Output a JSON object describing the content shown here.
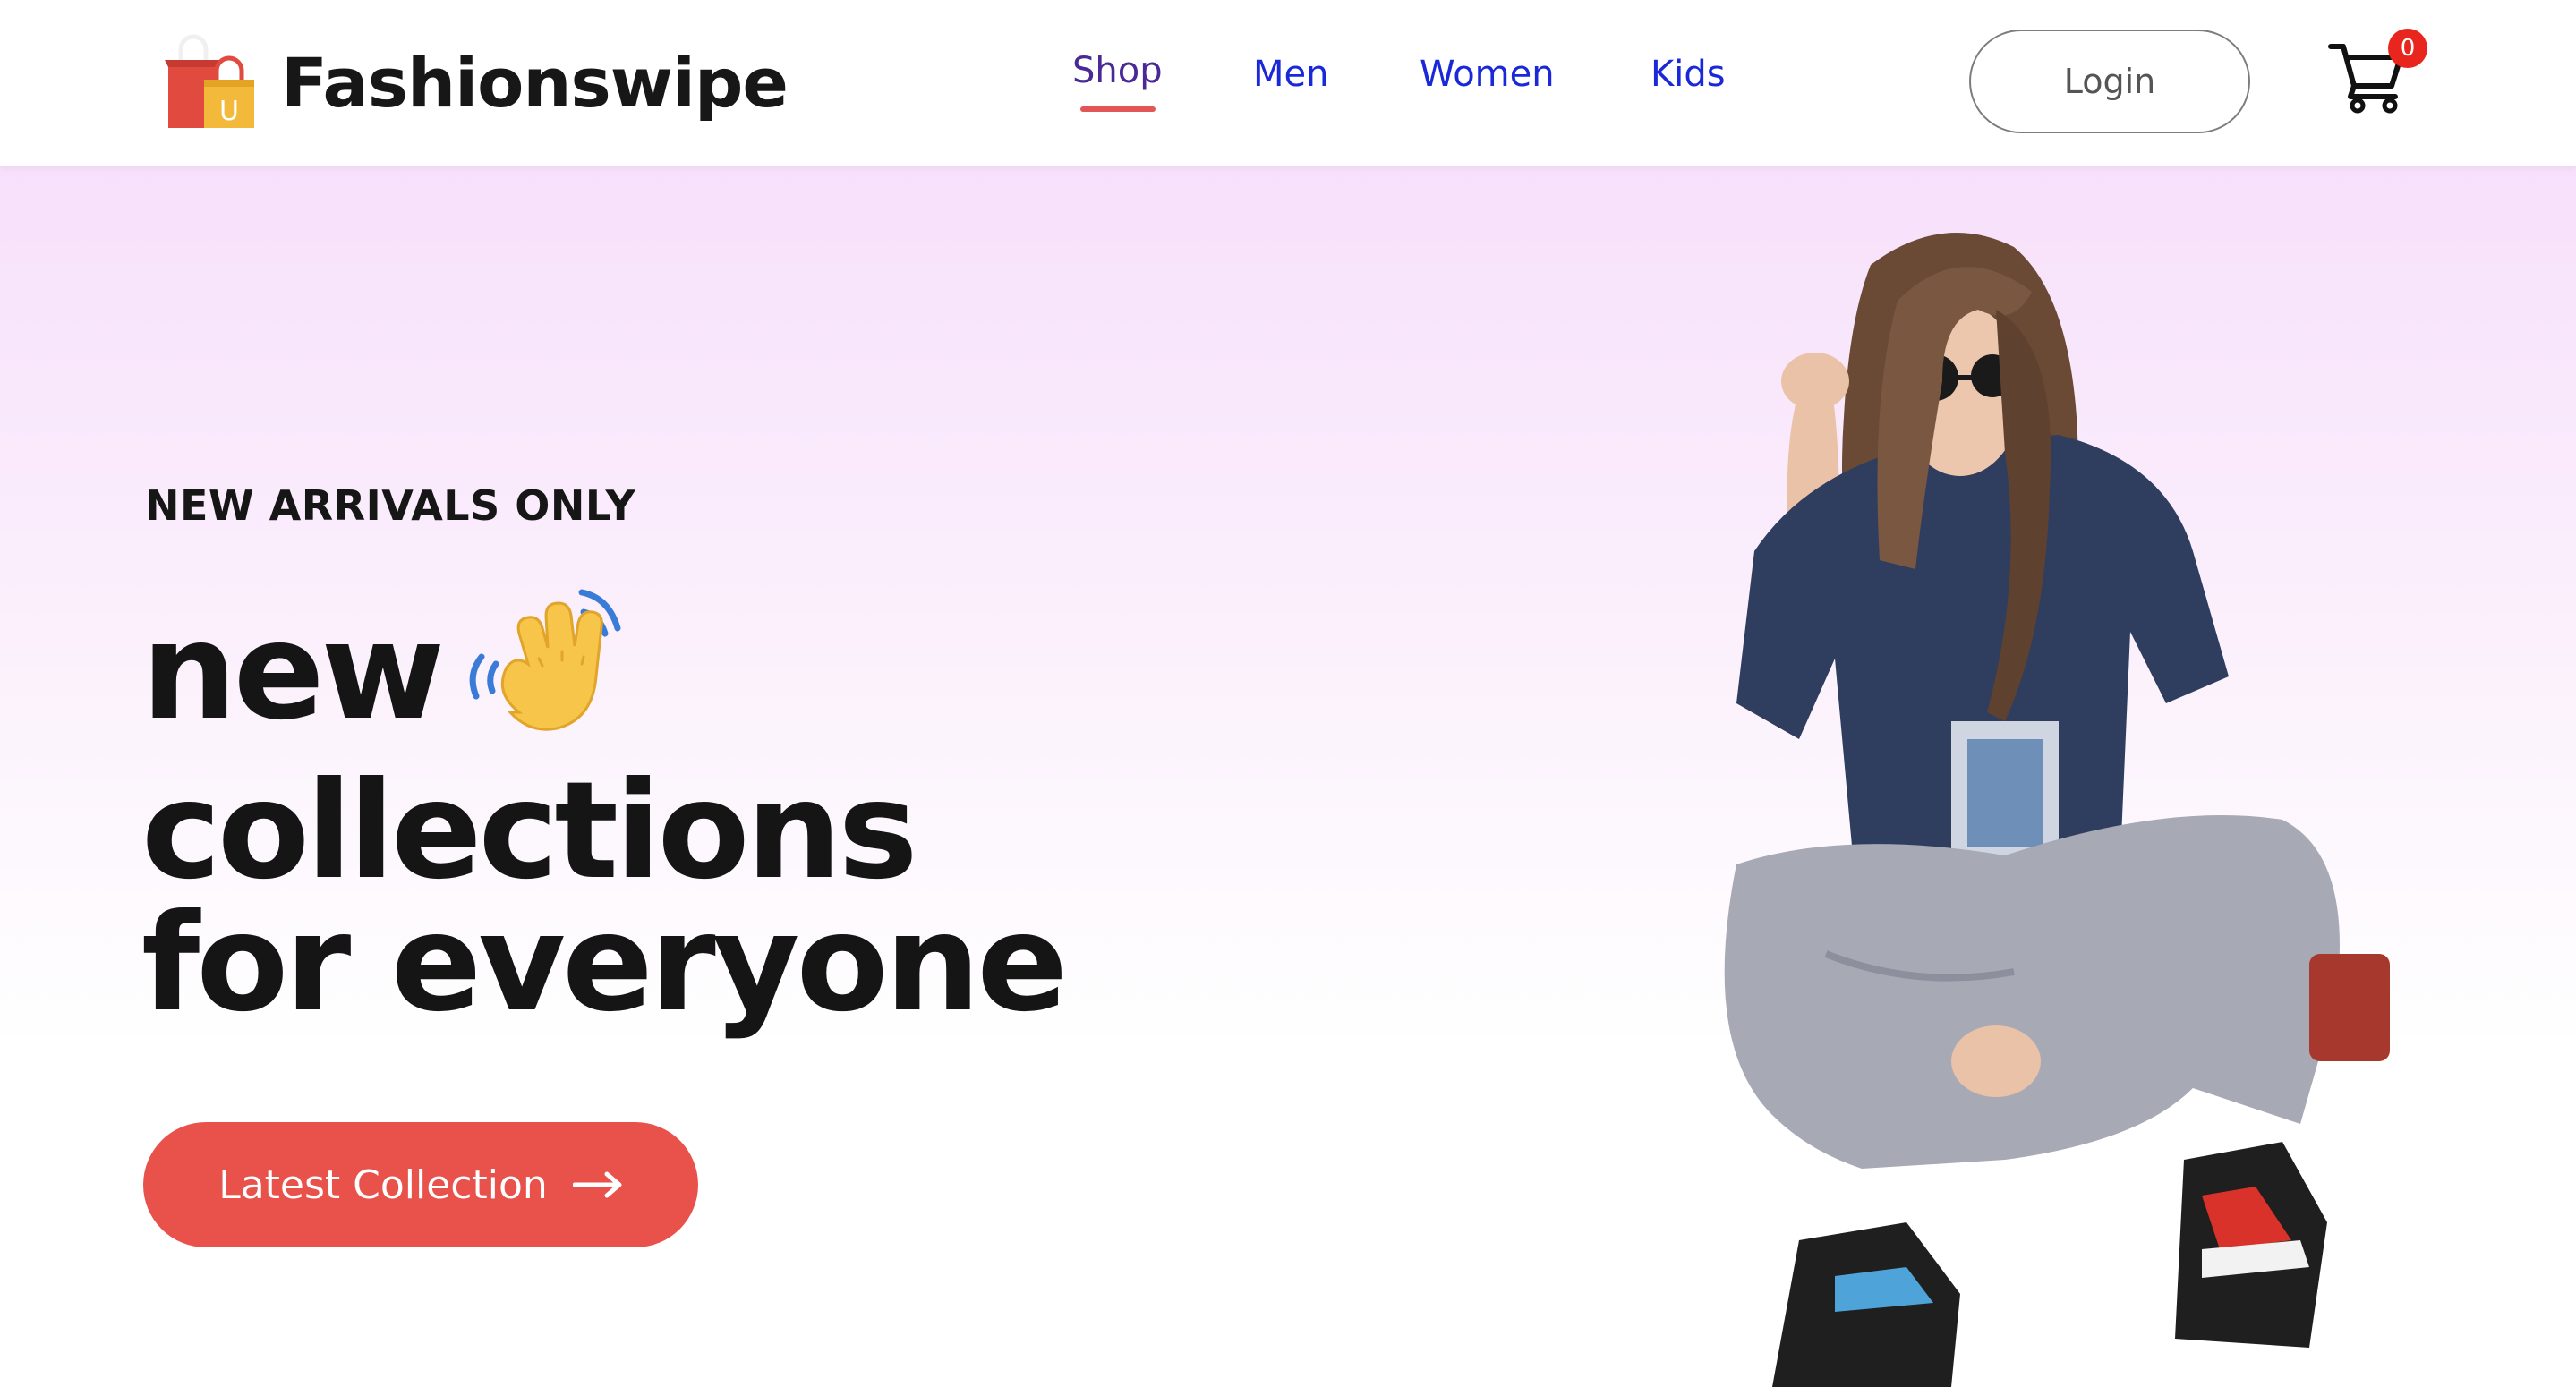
{
  "brand": {
    "name": "Fashionswipe",
    "logo_icon": "shopping-bags-icon",
    "logo_badge_letter": "U",
    "colors": {
      "bag_red": "#e14a3f",
      "bag_yellow": "#f3b93a"
    }
  },
  "nav": {
    "items": [
      {
        "label": "Shop",
        "active": true
      },
      {
        "label": "Men",
        "active": false
      },
      {
        "label": "Women",
        "active": false
      },
      {
        "label": "Kids",
        "active": false
      }
    ],
    "active_color": "#4a2996",
    "link_color": "#1a28d8",
    "underline_color": "#e25656"
  },
  "header": {
    "login_label": "Login",
    "cart_icon": "cart-icon",
    "cart_count": "0"
  },
  "hero": {
    "eyebrow": "NEW ARRIVALS ONLY",
    "headline": [
      "new",
      "collections",
      "for everyone"
    ],
    "wave_icon": "waving-hand-icon",
    "cta_label": "Latest Collection",
    "cta_icon": "arrow-right-icon",
    "cta_color": "#e8524b",
    "image_subject": "hero-model-photo",
    "gradient_top": "#f7e0fb"
  }
}
